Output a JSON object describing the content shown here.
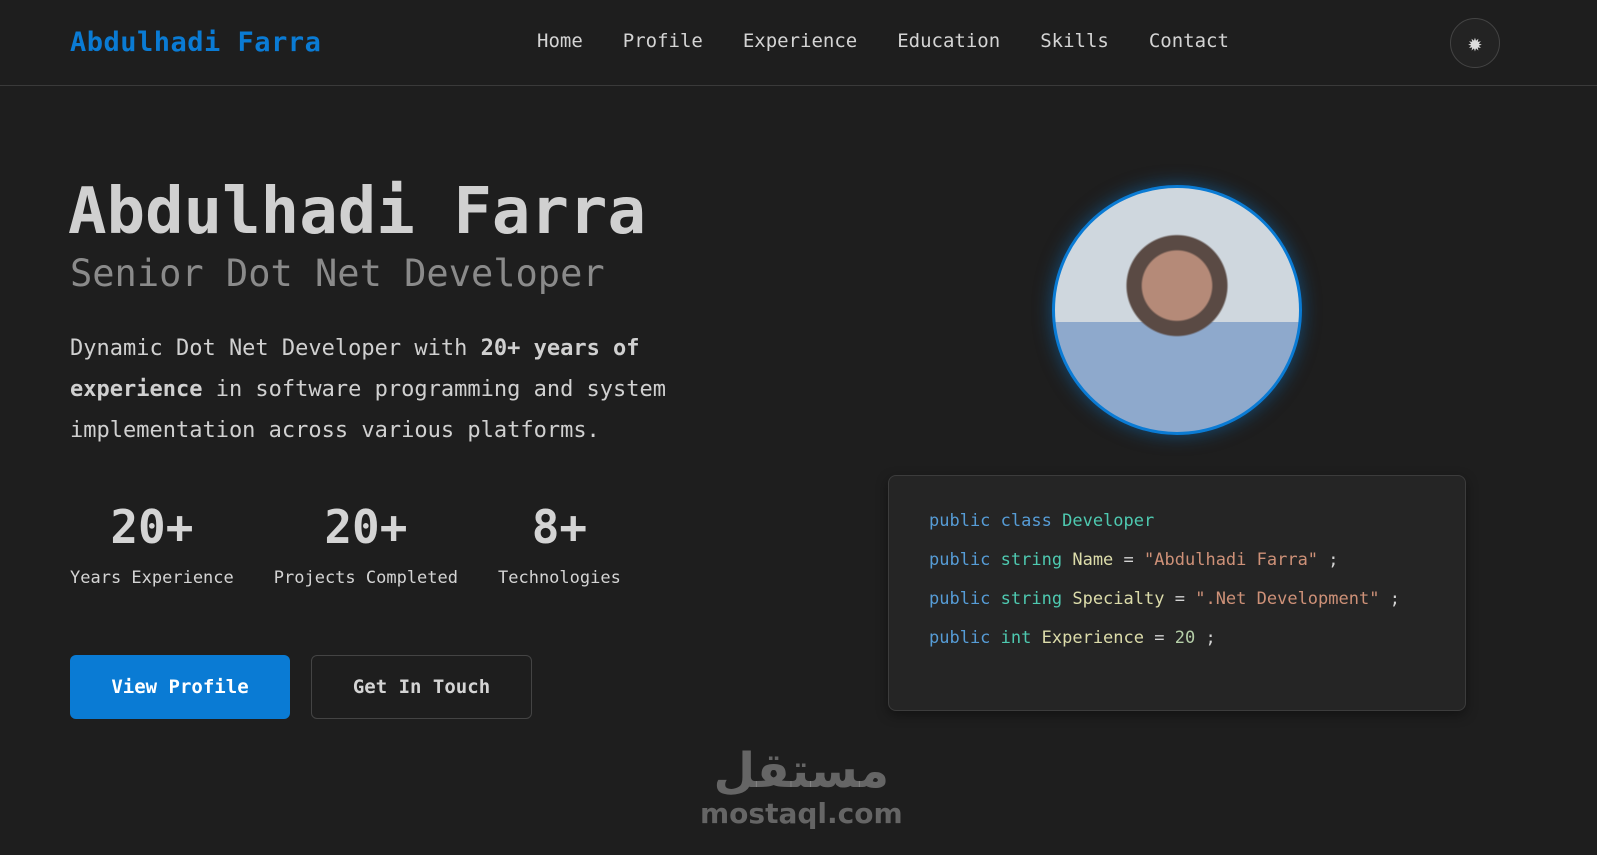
{
  "nav": {
    "brand": "Abdulhadi Farra",
    "links": [
      "Home",
      "Profile",
      "Experience",
      "Education",
      "Skills",
      "Contact"
    ],
    "theme_icon": "sun-icon"
  },
  "hero": {
    "name": "Abdulhadi Farra",
    "title": "Senior Dot Net Developer",
    "desc_pre": "Dynamic Dot Net Developer with ",
    "desc_bold": "20+ years of experience",
    "desc_post": " in software programming and system implementation across various platforms.",
    "stats": [
      {
        "value": "20+",
        "label": "Years Experience"
      },
      {
        "value": "20+",
        "label": "Projects Completed"
      },
      {
        "value": "8+",
        "label": "Technologies"
      }
    ],
    "primary_button": "View Profile",
    "secondary_button": "Get In Touch"
  },
  "code": {
    "public": "public",
    "class": "class",
    "string": "string",
    "int": "int",
    "class_name": "Developer",
    "name_prop": "Name",
    "name_val": "\"Abdulhadi Farra\"",
    "spec_prop": "Specialty",
    "spec_val": "\".Net Development\"",
    "exp_prop": "Experience",
    "exp_val": "20",
    "eq": "=",
    "semi": ";"
  },
  "watermark": {
    "arabic": "مستقل",
    "latin": "mostaql.com"
  }
}
